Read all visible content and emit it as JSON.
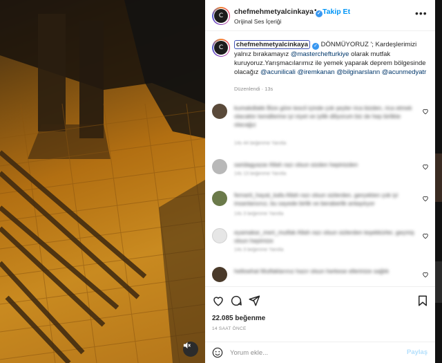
{
  "header": {
    "username": "chefmehmetyalcinkaya",
    "follow_label": "Takip Et",
    "audio_label": "Orijinal Ses İçeriği",
    "separator": "•"
  },
  "caption": {
    "username": "chefmehmetyalcinkaya",
    "part1": " DÖNMÜYORUZ '; Kardeşlerimizi yalnız bırakamayız ",
    "mention1": "@masterchefturkiye",
    "part2": " olarak mutfak kuruyoruz.Yarışmacılarımız ile yemek yaparak deprem bölgesinde olacağız ",
    "mention2": "@acunilicali",
    "mention3": "@iremkanan",
    "mention4": "@bilginarslann",
    "mention5": "@acunmedyatr",
    "meta": "Düzenlendi · 13s"
  },
  "comments": [
    {
      "text": "kumakdlakk Bize göre tescil içinde çok şeyler rica bizden, rica etmek olacaktır kendilerine iyi niyet ve iyilik diliyorum biz de hep birlikte olacağız",
      "meta": "14s   44 beğenme   Yanıtla",
      "avatar_color": "#5a4a3a"
    },
    {
      "text": "saridagyazar Allah razı olsun sizden hepinizden",
      "meta": "14s   13 beğenme   Yanıtla",
      "avatar_color": "#b8b8b8"
    },
    {
      "text": "fernarti_hayat_kafa Allah razı olsun sizlerden, gerçekten çok iyi insanlarsınız, bu sayede birlik ve beraberlik anlaşılıyor",
      "meta": "14s   3 beğenme   Yanıtla",
      "avatar_color": "#6b7a4a"
    },
    {
      "text": "eyamakar_mert_mutfak Allah razı olsun sizlerden teşekkürler, geçmiş olsun hepimize",
      "meta": "14s   3 beğenme   Yanıtla",
      "avatar_color": "#e0e0e0"
    },
    {
      "text": "hellowhat Mutfaklarınız hazır olsun herkese ellerinize sağlık",
      "meta": "14s   Yanıtla",
      "avatar_color": "#4a3a2a"
    }
  ],
  "actions": {
    "likes": "22.085 beğenme",
    "ago": "14 SAAT ÖNCE"
  },
  "comment_box": {
    "placeholder": "Yorum ekle...",
    "post_label": "Paylaş"
  },
  "icons": [
    "sound-off-icon",
    "verified-badge-icon",
    "more-icon",
    "heart-icon",
    "comment-icon",
    "share-icon",
    "bookmark-icon",
    "emoji-icon"
  ]
}
